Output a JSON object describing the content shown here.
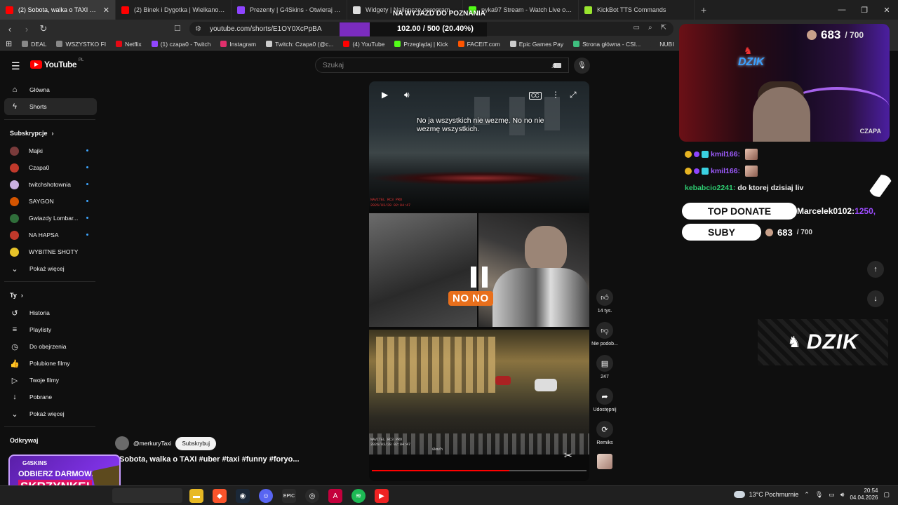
{
  "browser": {
    "tabs": [
      {
        "title": "(2) Sobota, walka o TAXI #uber",
        "color": "#ff0000",
        "active": true
      },
      {
        "title": "(2) Binek i Dygotka | Wielkanocny Ba",
        "color": "#ff0000"
      },
      {
        "title": "Prezenty | G4Skins - Otwieraj skrzynk",
        "color": "#8e44ff"
      },
      {
        "title": "Widgety | Najlepsze oprogramowanie",
        "color": "#dddddd"
      },
      {
        "title": "pyka97 Stream - Watch Live on Kick",
        "color": "#53fc18"
      },
      {
        "title": "KickBot TTS Commands",
        "color": "#9ae62f"
      }
    ],
    "close_glyph": "✕",
    "new_tab_glyph": "+",
    "window_controls": [
      "—",
      "❐",
      "✕"
    ],
    "url": "youtube.com/shorts/E1OY0XcPpBA",
    "bookmarks": [
      {
        "label": "DEAL",
        "color": "#888888"
      },
      {
        "label": "WSZYSTKO FI",
        "color": "#888888"
      },
      {
        "label": "Netflix",
        "color": "#e50914"
      },
      {
        "label": "(1) czapa0 - Twitch",
        "color": "#9146ff"
      },
      {
        "label": "Instagram",
        "color": "#e1306c"
      },
      {
        "label": "Twitch: Czapa0 (@c...",
        "color": "#cccccc"
      },
      {
        "label": "(4) YouTube",
        "color": "#ff0000"
      },
      {
        "label": "Przeglądaj | Kick",
        "color": "#53fc18"
      },
      {
        "label": "FACEIT.com",
        "color": "#ff5500"
      },
      {
        "label": "Epic Games Pay",
        "color": "#cccccc"
      },
      {
        "label": "Strona główna - CSI...",
        "color": "#3fbf7f"
      },
      {
        "label": "NUBI",
        "color": "#2b2b2b"
      },
      {
        "label": "STRONY",
        "color": "#888888"
      }
    ]
  },
  "youtube": {
    "logo_text": "YouTube",
    "country": "PL",
    "search_placeholder": "Szukaj",
    "nav": [
      {
        "label": "Główna",
        "icon": "home-icon",
        "glyph": "⌂"
      },
      {
        "label": "Shorts",
        "icon": "shorts-icon",
        "glyph": "ϟ",
        "active": true
      }
    ],
    "subs_header": "Subskrypcje",
    "subscriptions": [
      {
        "label": "Majki",
        "color": "#7a3b3b",
        "dot": true
      },
      {
        "label": "Czapa0",
        "color": "#c0392b",
        "dot": true
      },
      {
        "label": "twitchshotownia",
        "color": "#c9b0e0",
        "dot": true
      },
      {
        "label": "SAYGON",
        "color": "#d35400",
        "dot": true
      },
      {
        "label": "Gwiazdy Lombar...",
        "color": "#2f6e3a",
        "dot": true
      },
      {
        "label": "NA HAPSA",
        "color": "#c0392b",
        "dot": true
      },
      {
        "label": "WYBITNE SHOTY",
        "color": "#e6c229",
        "dot": false
      },
      {
        "label": "Pokaż więcej",
        "color": "",
        "dot": false
      }
    ],
    "you_header": "Ty",
    "you_items": [
      {
        "label": "Historia",
        "glyph": "↺"
      },
      {
        "label": "Playlisty",
        "glyph": "≡"
      },
      {
        "label": "Do obejrzenia",
        "glyph": "◷"
      },
      {
        "label": "Polubione filmy",
        "glyph": "👍"
      },
      {
        "label": "Twoje filmy",
        "glyph": "▷"
      },
      {
        "label": "Pobrane",
        "glyph": "↓"
      },
      {
        "label": "Pokaż więcej",
        "glyph": "⌄"
      }
    ],
    "explore_header": "Odkrywaj",
    "short": {
      "caption": "No ja wszystkich nie wezmę. No no nie wezmę wszystkich.",
      "overlay_text": "NO NO",
      "progress": 0.64,
      "likes": "14 tys.",
      "dislike": "Nie podob...",
      "comments": "247",
      "share": "Udostępnij",
      "remix": "Remiks",
      "channel": "@merkuryTaxi",
      "subscribe": "Subskrybuj",
      "title": "Sobota, walka o TAXI #uber #taxi #funny #foryo...",
      "cam_label": "NAVITEL RC3 PRO",
      "cam_date": "2026/03/28 02:04:47",
      "cam_speed": "0km/h"
    }
  },
  "stream": {
    "goal_title": "NA WYJAZD DO POZNANIA",
    "goal_value": "102.00 / 500 (20.40%)",
    "goal_fraction": 0.204,
    "subs_current": "683",
    "subs_target": "/ 700",
    "streamer_tag": "CZAPA",
    "cam_logo": "DZIK",
    "chat": [
      {
        "user": "kmil166:",
        "msg": "",
        "badges": true
      },
      {
        "user": "kmil166:",
        "msg": "",
        "badges": true
      },
      {
        "user": "kebabcio2241:",
        "msg": "do ktorej dzisiaj liv",
        "badges": false
      }
    ],
    "top_donate_label": "TOP DONATE",
    "top_donate_name": "Marcelek0102:",
    "top_donate_amount": "1250,",
    "suby_label": "SUBY",
    "dzik_banner": "DZIK",
    "promo": {
      "brand": "G4SKINS",
      "line1": "ODBIERZ DARMOWĄ",
      "line2": "SKRZYNKĘ!"
    }
  },
  "taskbar": {
    "weather": "13°C  Pochmurnie",
    "time": "20:54",
    "date": "04.04.2026"
  }
}
